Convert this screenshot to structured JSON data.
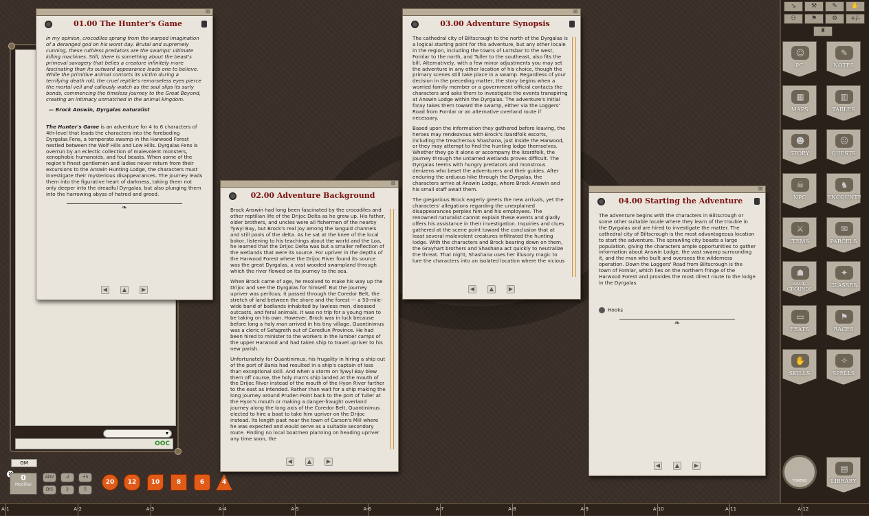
{
  "windows": {
    "hunters": {
      "title": "01.00 The Hunter's Game",
      "quote": "In my opinion, crocodiles sprang from the warped imagination of a deranged god on his worst day. Brutal and supremely cunning, these ruthless predators are the swamps' ultimate killing machines. Still, there is something about the beast's primeval savagery that belies a creature infinitely more fascinating than its outward appearance leads one to believe. While the primitive animal contorts its victim during a terrifying death roll, the cruel reptile's remorseless eyes pierce the mortal veil and callously watch as the soul slips its surly bonds, commencing the timeless journey to the Great Beyond, creating an intimacy unmatched in the animal kingdom.",
      "signature": "— Brock Answin, Dyrgalas naturalist",
      "lead": "The Hunter's Game",
      "text": " is an adventure for 4 to 6 characters of 4th-level that leads the characters into the foreboding Dyrgalas Fens, a temperate swamp in the Harwood Forest nestled between the Wolf Hills and Low Hills. Dyrgalas Fens is overrun by an eclectic collection of malevolent monsters, xenophobic humanoids, and foul beasts. When some of the region's finest gentlemen and ladies never return from their excursions to the Answin Hunting Lodge, the characters must investigate their mysterious disappearances. The journey leads them into the figurative heart of darkness, taking them not only deeper into the dreadful Dyrgalas, but also plunging them into the harrowing abyss of hatred and greed."
    },
    "background": {
      "title": "02.00 Adventure Background",
      "p1": "Brock Answin had long been fascinated by the crocodiles and other reptilian life of the Drijoc Delta as he grew up. His father, older brothers, and uncles were all fishermen of the nearby Tywyl Bay, but Brock's real joy among the languid channels and still pools of the delta. As he sat at the knee of the local bokor, listening to his teachings about the world and the Loa, he learned that the Drijoc Delta was but a smaller reflection of the wetlands that were its source. For upriver in the depths of the Harwood Forest where the Drijoc River found its source was the great Dyrgalas, a vast wooded swampland through which the river flowed on its journey to the sea.",
      "p2": "When Brock came of age, he resolved to make his way up the Drijoc and see the Dyrgalas for himself. But the journey upriver was perilous; it passed through the Coredor Belt, the stretch of land between the shore and the forest — a 50-mile-wide band of badlands inhabited by lawless men, diseased outcasts, and feral animals. It was no trip for a young man to be taking on his own. However, Brock was in luck because before long a holy man arrived in his tiny village. Quantinimus was a cleric of Sefagreth out of Ceredlun Province. He had been hired to minister to the workers in the lumber camps of the upper Harwood and had taken ship to travel upriver to his new parish.",
      "p3": "Unfortunately for Quantinimus, his frugality in hiring a ship out of the port of Banis had resulted in a ship's captain of less than exceptional skill. And when a storm on Tywyl Bay blew them off course, the holy man's ship landed at the mouth of the Drijoc River instead of the mouth of the Hyon River farther to the east as intended. Rather than wait for a ship making the long journey around Pruden Point back to the port of Tuller at the Hyon's mouth or making a danger-fraught overland journey along the long axis of the Coredor Belt, Quantinimus elected to hire a boat to take him upriver on the Drijoc instead. Its length past near the town of Carson's Mill where he was expected and would serve as a suitable secondary route. Finding no local boatmen planning on heading upriver any time soon, the"
    },
    "synopsis": {
      "title": "03.00 Adventure Synopsis",
      "p1": "The cathedral city of Biltscrough to the north of the Dyrgalas is a logical starting point for this adventure, but any other locale in the region, including the towns of Lortsbar to the west, Fornlar to the north, and Tuller to the southeast, also fits the bill. Alternatively, with a few minor adjustments you may set the adventure in any other location of his choice, though the primary scenes still take place in a swamp. Regardless of your decision in the preceding matter, the story begins when a worried family member or a government official contacts the characters and asks them to investigate the events transpiring at Answin Lodge within the Dyrgalas. The adventure's initial foray takes them toward the swamp, either via the Loggers' Road from Fornlar or an alternative overland route if necessary.",
      "p2": "Based upon the information they gathered before leaving, the heroes may rendezvous with Brock's lizardfolk escorts, including the treacherous Shashana, just inside the Harwood, or they may attempt to find the hunting lodge themselves. Whether they go it alone or accompany the lizardfolk, the journey through the untamed wetlands proves difficult. The Dyrgalas teems with hungry predators and monstrous denizens who beset the adventurers and their guides. After enduring the arduous hike through the Dyrgalas, the characters arrive at Answin Lodge, where Brock Answin and his small staff await them.",
      "p3": "The gregarious Brock eagerly greets the new arrivals, yet the characters' allegations regarding the unexplained disappearances perplex him and his employees. The renowned naturalist cannot explain these events and gladly offers his assistance in their investigation. Inquiries and clues gathered at the scene point toward the conclusion that at least several malevolent creatures infiltrated the hunting lodge. With the characters and Brock bearing down on them, the Grayhart brothers and Shashana act quickly to neutralize the threat. That night, Shashana uses her illusory magic to lure the characters into an isolated location where the vicious"
    },
    "starting": {
      "title": "04.00 Starting the Adventure",
      "p1": "The adventure begins with the characters in Biltscrough or some other suitable locale where they learn of the trouble in the Dyrgalas and are hired to investigate the matter. The cathedral city of Biltscrough is the most advantageous location to start the adventure. The sprawling city boasts a large population, giving the characters ample opportunities to gather information about Answin Lodge, the vast swamp surrounding it, and the man who built and oversees the wilderness operation. Down the Loggers' Road from Biltscrough is the town of Fornlar, which lies on the northern fringe of the Harwood Forest and provides the most direct route to the lodge in the Dyrgalas.",
      "hooks": "Hooks"
    }
  },
  "chat": {
    "mode": "OOC",
    "gm": "GM"
  },
  "modifier": {
    "value": "0",
    "label": "Modifier"
  },
  "mod_buttons": [
    "ADV",
    "-2",
    "+5",
    "DIS",
    "2",
    "5"
  ],
  "dice": [
    "20",
    "12",
    "10",
    "8",
    "6",
    "4"
  ],
  "tools": [
    "↘",
    "⚒",
    "✎",
    "✋",
    "⚇",
    "⚑",
    "⚙",
    "+/-",
    "♜"
  ],
  "library": [
    [
      "PC",
      "NOTES"
    ],
    [
      "MAPS",
      "TABLES"
    ],
    [
      "STORY",
      "QUESTS"
    ],
    [
      "NPC",
      "ENCOUNTERS"
    ],
    [
      "ITEMS",
      "PARCELS"
    ],
    [
      "BACK-\nGROUNDS",
      "CLASSES"
    ],
    [
      "FEATS",
      "RACES"
    ],
    [
      "SKILLS",
      "SPELLS"
    ]
  ],
  "bottom_buttons": {
    "tokens": "TOKENS",
    "library": "LIBRARY"
  },
  "grid_labels": [
    "A-1",
    "A-2",
    "A-3",
    "A-4",
    "A-5",
    "A-6",
    "A-7",
    "A-8",
    "A-9",
    "A-10",
    "A-11",
    "A-12"
  ]
}
